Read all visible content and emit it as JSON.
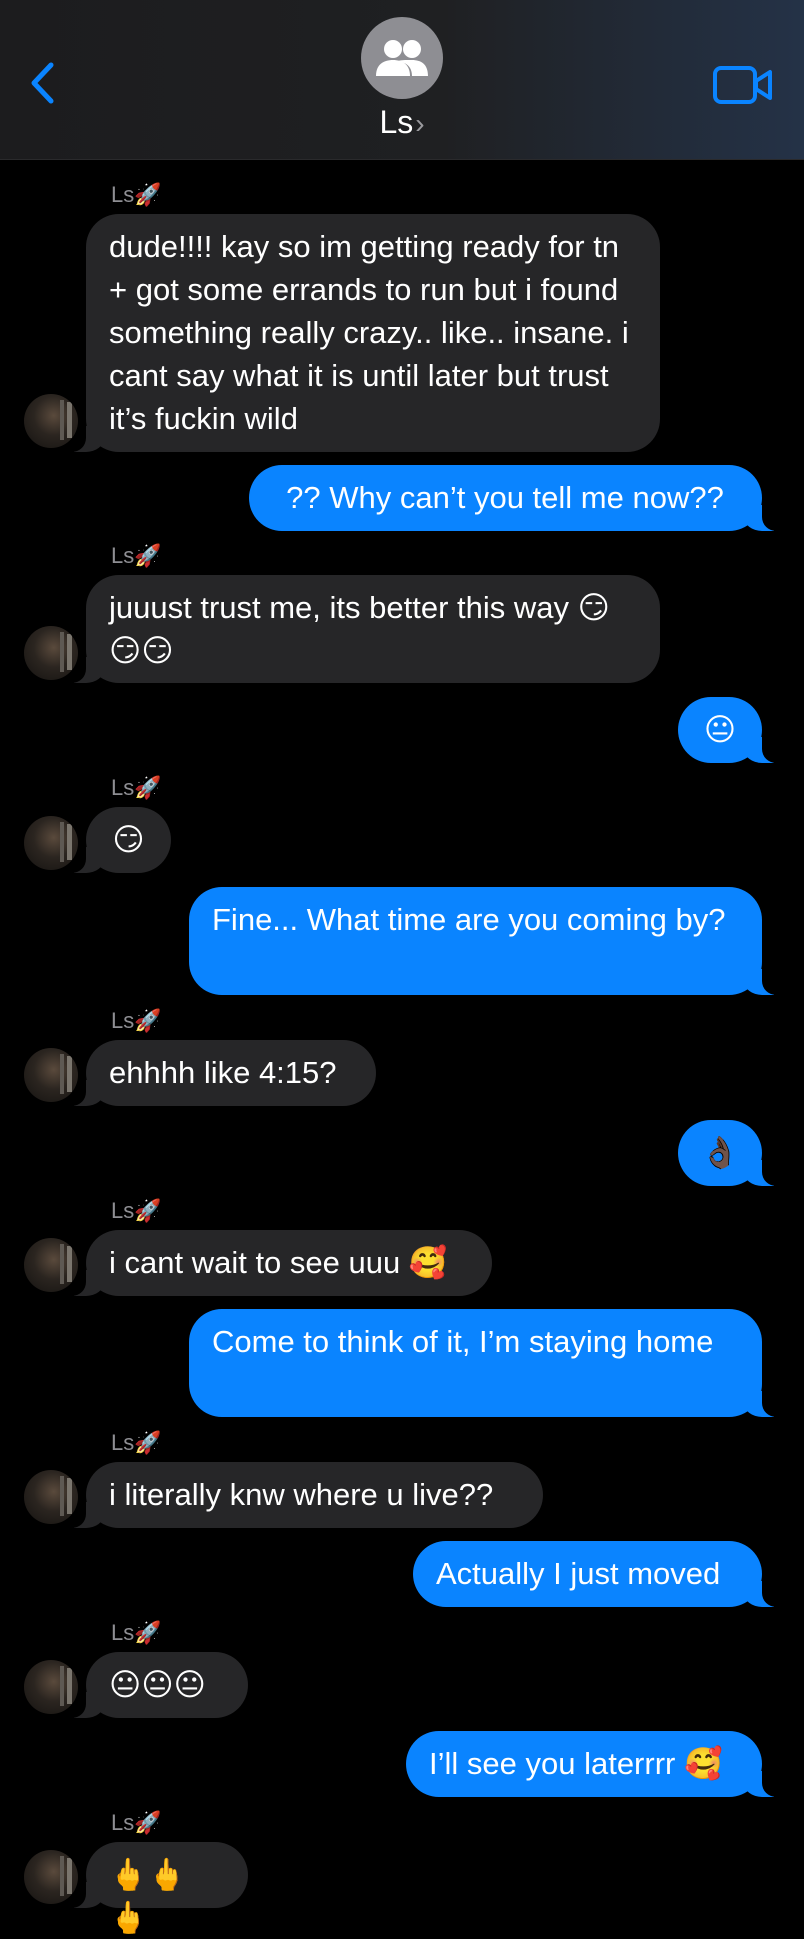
{
  "header": {
    "contact_name": "Ls",
    "chevron": "›",
    "back_icon": "chevron-left-icon",
    "video_icon": "video-camera-icon",
    "group_avatar_icon": "people-icon",
    "accent_color": "#0a84ff"
  },
  "sender_label": "Ls🚀",
  "messages": [
    {
      "from": "them",
      "text": "dude!!!! kay so im getting ready for tn + got some errands to run but i found something really crazy.. like.. insane. i cant say what it is until later but trust it’s fuckin wild"
    },
    {
      "from": "me",
      "text": "?? Why can’t you tell me now??"
    },
    {
      "from": "them",
      "text": "juuust trust me, its better this way 😏😏😏"
    },
    {
      "from": "me",
      "text": "😐"
    },
    {
      "from": "them",
      "text": "😏"
    },
    {
      "from": "me",
      "text": "Fine... What time are you coming by?"
    },
    {
      "from": "them",
      "text": "ehhhh like 4:15?"
    },
    {
      "from": "me",
      "text": "👌🏿"
    },
    {
      "from": "them",
      "text": "i cant wait to see uuu 🥰"
    },
    {
      "from": "me",
      "text": "Come to think of it, I’m staying home"
    },
    {
      "from": "them",
      "text": "i literally knw where u live??"
    },
    {
      "from": "me",
      "text": "Actually I just moved"
    },
    {
      "from": "them",
      "text": "😐😐😐"
    },
    {
      "from": "me",
      "text": "I’ll see you laterrrr 🥰"
    },
    {
      "from": "them",
      "text": "🖕🖕🖕"
    }
  ]
}
